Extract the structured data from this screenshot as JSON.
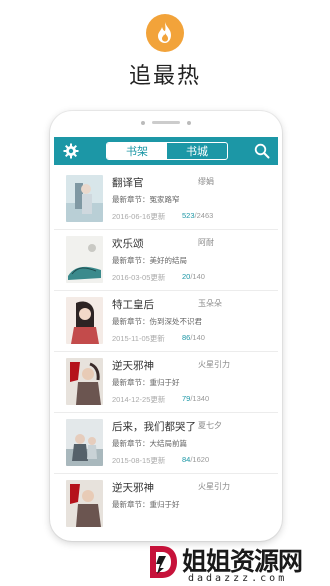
{
  "hero": {
    "title": "追最热",
    "icon": "flame-icon",
    "icon_color": "#f2a33a"
  },
  "app": {
    "accent_color": "#1c97a6",
    "tabs": [
      {
        "label": "书架",
        "active": true
      },
      {
        "label": "书城",
        "active": false
      }
    ],
    "settings_icon": "gear-icon",
    "search_icon": "search-icon"
  },
  "books": [
    {
      "title": "翻译官",
      "author": "缪娟",
      "chapter": "最新章节：冤家路窄",
      "date": "2016-06-16更新",
      "progress_current": "523",
      "progress_total": "/2463"
    },
    {
      "title": "欢乐颂",
      "author": "阿耐",
      "chapter": "最新章节：美好的结局",
      "date": "2016-03-05更新",
      "progress_current": "20",
      "progress_total": "/140"
    },
    {
      "title": "特工皇后",
      "author": "玉朵朵",
      "chapter": "最新章节：伤到深处不识君",
      "date": "2015-11-05更新",
      "progress_current": "86",
      "progress_total": "/140"
    },
    {
      "title": "逆天邪神",
      "author": "火星引力",
      "chapter": "最新章节：重归于好",
      "date": "2014-12-25更新",
      "progress_current": "79",
      "progress_total": "/1340"
    },
    {
      "title": "后来，我们都哭了",
      "author": "夏七夕",
      "chapter": "最新章节：大结局前篇",
      "date": "2015-08-15更新",
      "progress_current": "84",
      "progress_total": "/1620"
    },
    {
      "title": "逆天邪神",
      "author": "火星引力",
      "chapter": "最新章节：重归于好",
      "date": "",
      "progress_current": "",
      "progress_total": ""
    }
  ],
  "watermark": {
    "text": "姐姐资源网",
    "sub": "dadazzz.com",
    "color": "#c6123a"
  }
}
